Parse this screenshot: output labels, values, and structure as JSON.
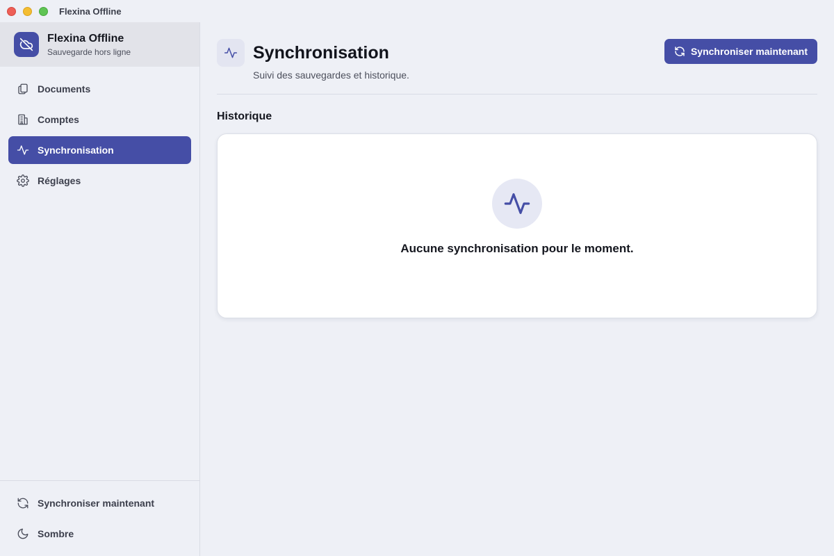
{
  "window": {
    "title": "Flexina Offline"
  },
  "brand": {
    "name": "Flexina Offline",
    "subtitle": "Sauvegarde hors ligne",
    "icon": "cloud-off-icon"
  },
  "sidebar": {
    "items": [
      {
        "label": "Documents",
        "icon": "documents-icon",
        "active": false
      },
      {
        "label": "Comptes",
        "icon": "building-icon",
        "active": false
      },
      {
        "label": "Synchronisation",
        "icon": "activity-icon",
        "active": true
      },
      {
        "label": "Réglages",
        "icon": "gear-icon",
        "active": false
      }
    ],
    "footer": [
      {
        "label": "Synchroniser maintenant",
        "icon": "refresh-icon"
      },
      {
        "label": "Sombre",
        "icon": "moon-icon"
      }
    ]
  },
  "page": {
    "title": "Synchronisation",
    "subtitle": "Suivi des sauvegardes et historique.",
    "icon": "activity-icon",
    "action_label": "Synchroniser maintenant"
  },
  "history": {
    "section_title": "Historique",
    "empty_message": "Aucune synchronisation pour le moment.",
    "empty_icon": "activity-icon"
  },
  "colors": {
    "accent": "#454ea6",
    "background": "#eef0f6",
    "card": "#ffffff"
  }
}
